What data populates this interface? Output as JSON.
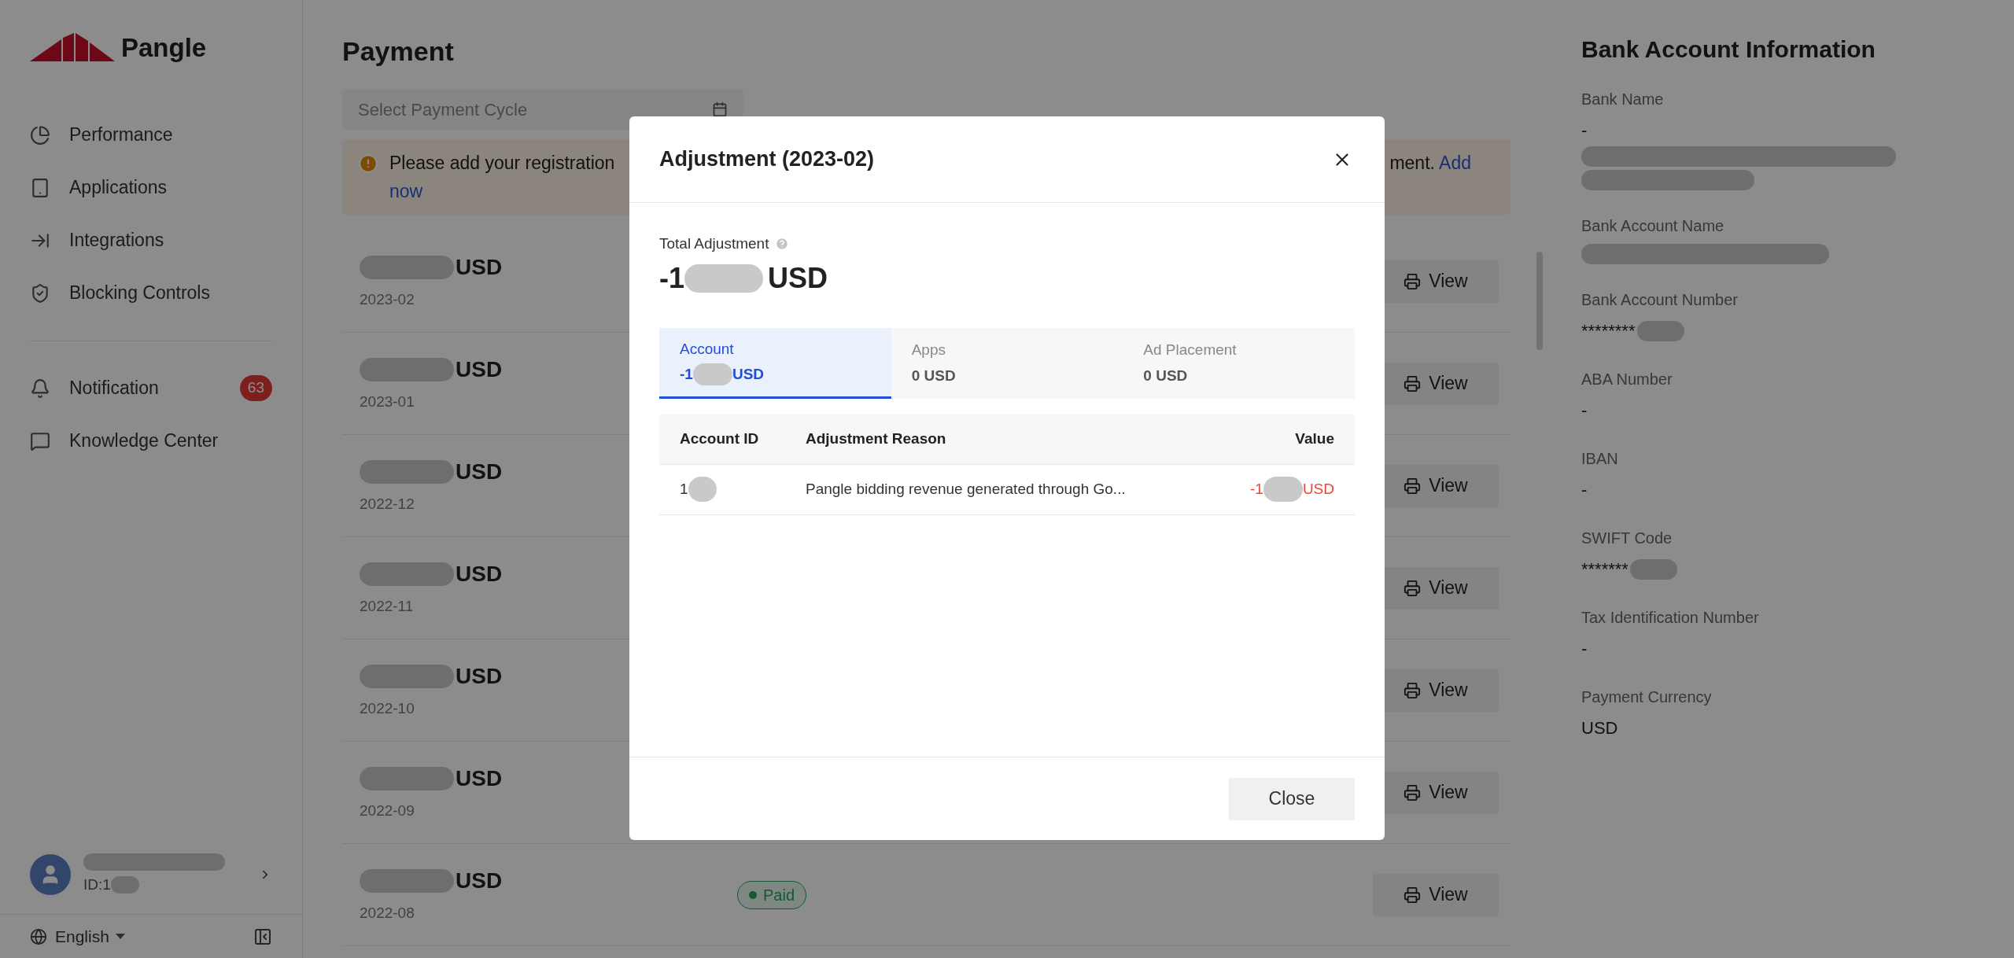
{
  "sidebar": {
    "logo": "Pangle",
    "nav": [
      {
        "label": "Performance"
      },
      {
        "label": "Applications"
      },
      {
        "label": "Integrations"
      },
      {
        "label": "Blocking Controls"
      }
    ],
    "nav_secondary": [
      {
        "label": "Notification",
        "badge": "63"
      },
      {
        "label": "Knowledge Center"
      }
    ],
    "user": {
      "id": "ID:1"
    },
    "language": "English"
  },
  "main": {
    "title": "Payment",
    "cycle_picker": {
      "placeholder": "Select Payment Cycle"
    },
    "notice": {
      "text_start": "Please add your registration",
      "text_end": "ment.",
      "link": "Add now"
    },
    "payments": [
      {
        "currency": "USD",
        "period": "2023-02",
        "action": "View"
      },
      {
        "currency": "USD",
        "period": "2023-01",
        "action": "View"
      },
      {
        "currency": "USD",
        "period": "2022-12",
        "action": "View"
      },
      {
        "currency": "USD",
        "period": "2022-11",
        "action": "View"
      },
      {
        "currency": "USD",
        "period": "2022-10",
        "action": "View"
      },
      {
        "currency": "USD",
        "period": "2022-09",
        "action": "View"
      },
      {
        "currency": "USD",
        "period": "2022-08",
        "status": "Paid",
        "action": "View"
      }
    ]
  },
  "bank_info": {
    "title": "Bank Account Information",
    "fields": [
      {
        "label": "Bank Name",
        "value": "-",
        "redacted": true
      },
      {
        "label": "Bank Account Name",
        "redacted": true
      },
      {
        "label": "Bank Account Number",
        "value": "********",
        "redacted": true
      },
      {
        "label": "ABA Number",
        "value": "-"
      },
      {
        "label": "IBAN",
        "value": "-"
      },
      {
        "label": "SWIFT Code",
        "value": "*******",
        "redacted": true
      },
      {
        "label": "Tax Identification Number",
        "value": "-"
      },
      {
        "label": "Payment Currency",
        "value": "USD"
      }
    ]
  },
  "modal": {
    "title": "Adjustment (2023-02)",
    "total": {
      "label": "Total Adjustment",
      "prefix": "-1",
      "currency": "USD"
    },
    "tabs": [
      {
        "label": "Account",
        "prefix": "-1",
        "currency": "USD",
        "redacted": true,
        "selected": true
      },
      {
        "label": "Apps",
        "value": "0 USD",
        "selected": false
      },
      {
        "label": "Ad Placement",
        "value": "0 USD",
        "selected": false
      }
    ],
    "table": {
      "columns": [
        "Account ID",
        "Adjustment Reason",
        "Value"
      ],
      "rows": [
        {
          "account_id": "1",
          "reason": "Pangle bidding revenue generated through Go...",
          "value_prefix": "-1",
          "value_currency": "USD"
        }
      ]
    },
    "close_button": "Close"
  }
}
